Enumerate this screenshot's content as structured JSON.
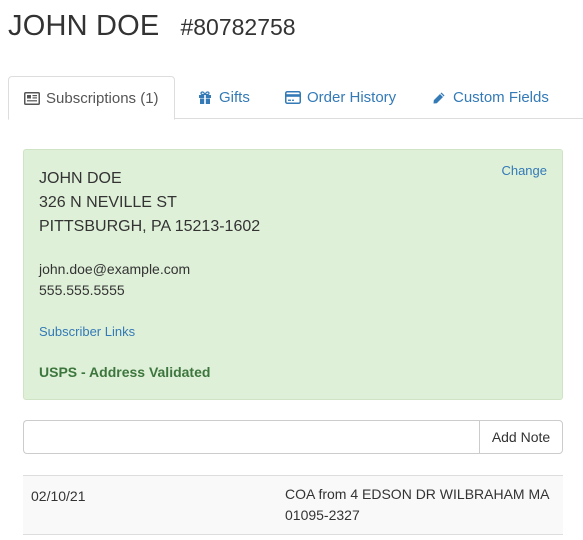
{
  "header": {
    "name": "JOHN DOE",
    "customer_id": "#80782758"
  },
  "tabs": [
    {
      "label": "Subscriptions (1)",
      "icon": "newspaper-icon",
      "active": true
    },
    {
      "label": "Gifts",
      "icon": "gift-icon",
      "active": false
    },
    {
      "label": "Order History",
      "icon": "credit-card-icon",
      "active": false
    },
    {
      "label": "Custom Fields",
      "icon": "pencil-icon",
      "active": false
    }
  ],
  "subscriber": {
    "change_label": "Change",
    "address_lines": [
      "JOHN DOE",
      "326 N NEVILLE ST",
      "PITTSBURGH, PA 15213-1602"
    ],
    "email": "john.doe@example.com",
    "phone": "555.555.5555",
    "links_label": "Subscriber Links",
    "validation_status": "USPS - Address Validated"
  },
  "note_entry": {
    "value": "",
    "button_label": "Add Note"
  },
  "notes": [
    {
      "date": "02/10/21",
      "text": "COA from 4 EDSON DR WILBRAHAM MA 01095-2327"
    }
  ],
  "colors": {
    "link": "#337ab7",
    "card_bg": "#dff0d8",
    "success_text": "#3c763d"
  }
}
